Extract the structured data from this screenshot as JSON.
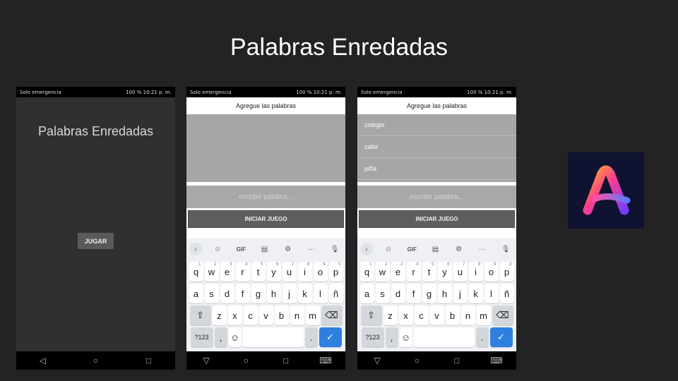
{
  "slide_title": "Palabras Enredadas",
  "status_bar": {
    "left": "Solo emergencia",
    "right": "100 %  10:21 p. m."
  },
  "phone1": {
    "app_title": "Palabras Enredadas",
    "play_button": "JUGAR"
  },
  "phone2": {
    "header": "Agregue las palabras",
    "input_placeholder": "escribir palabra...",
    "start_button": "INICIAR JUEGO"
  },
  "phone3": {
    "header": "Agregue las palabras",
    "words": [
      "colegio",
      "calor",
      "piña"
    ],
    "input_placeholder": "escribir palabra...",
    "start_button": "INICIAR JUEGO"
  },
  "keyboard": {
    "toolbar": [
      "back-icon",
      "sticker-icon",
      "GIF",
      "clipboard-icon",
      "settings-icon",
      "more-icon",
      "mic-icon"
    ],
    "gif_label": "GIF",
    "more_label": "···",
    "row1": [
      {
        "k": "q",
        "n": "1"
      },
      {
        "k": "w",
        "n": "2"
      },
      {
        "k": "e",
        "n": "3"
      },
      {
        "k": "r",
        "n": "4"
      },
      {
        "k": "t",
        "n": "5"
      },
      {
        "k": "y",
        "n": "6"
      },
      {
        "k": "u",
        "n": "7"
      },
      {
        "k": "i",
        "n": "8"
      },
      {
        "k": "o",
        "n": "9"
      },
      {
        "k": "p",
        "n": "0"
      }
    ],
    "row2": [
      "a",
      "s",
      "d",
      "f",
      "g",
      "h",
      "j",
      "k",
      "l",
      "ñ"
    ],
    "row3": [
      "z",
      "x",
      "c",
      "v",
      "b",
      "n",
      "m"
    ],
    "sym_label": "?123",
    "comma_label": ",",
    "period_label": "."
  },
  "colors": {
    "background": "#232323",
    "enter_key": "#2f7fe0",
    "logo_bg": "#0f1230"
  }
}
